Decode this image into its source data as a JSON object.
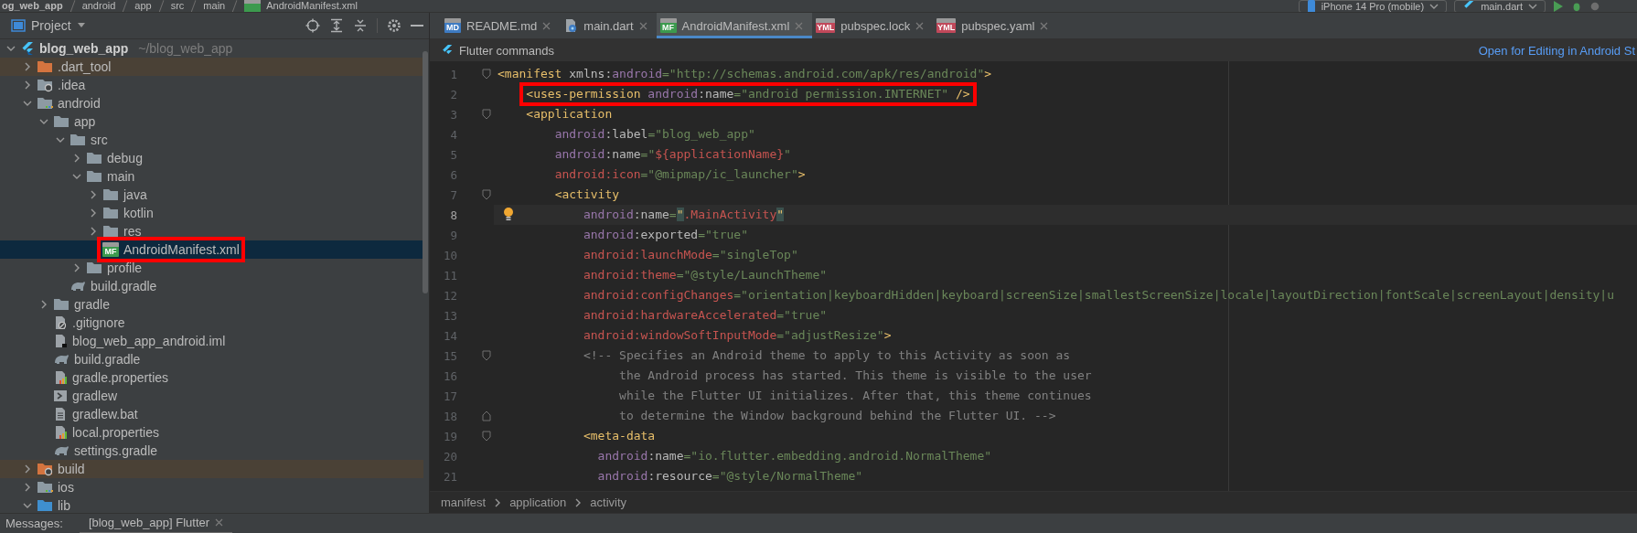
{
  "top_strip": {
    "breadcrumb": [
      "og_web_app",
      "android",
      "app",
      "src",
      "main",
      "AndroidManifest.xml"
    ],
    "device": "iPhone 14 Pro (mobile)",
    "run_config": "main.dart"
  },
  "project_panel": {
    "title": "Project",
    "tree": [
      {
        "label": "blog_web_app",
        "path": "~/blog_web_app",
        "kind": "flutter-project",
        "expanded": true,
        "selected": false,
        "children": [
          {
            "label": ".dart_tool",
            "kind": "folder",
            "expanded": false,
            "excluded": true,
            "selected": false
          },
          {
            "label": ".idea",
            "kind": "config-folder",
            "expanded": false,
            "selected": false
          },
          {
            "label": "android",
            "kind": "module-folder",
            "expanded": true,
            "selected": false,
            "children": [
              {
                "label": "app",
                "kind": "folder",
                "expanded": true,
                "selected": false,
                "children": [
                  {
                    "label": "src",
                    "kind": "folder",
                    "expanded": true,
                    "selected": false,
                    "children": [
                      {
                        "label": "debug",
                        "kind": "folder",
                        "expanded": false,
                        "selected": false
                      },
                      {
                        "label": "main",
                        "kind": "folder",
                        "expanded": true,
                        "selected": false,
                        "children": [
                          {
                            "label": "java",
                            "kind": "folder",
                            "expanded": false,
                            "selected": false
                          },
                          {
                            "label": "kotlin",
                            "kind": "folder",
                            "expanded": false,
                            "selected": false
                          },
                          {
                            "label": "res",
                            "kind": "folder",
                            "expanded": false,
                            "selected": false
                          },
                          {
                            "label": "AndroidManifest.xml",
                            "kind": "manifest",
                            "badge": "MF",
                            "selected": true,
                            "annotated": true
                          }
                        ]
                      },
                      {
                        "label": "profile",
                        "kind": "folder",
                        "expanded": false,
                        "selected": false
                      }
                    ]
                  },
                  {
                    "label": "build.gradle",
                    "kind": "gradle",
                    "selected": false
                  }
                ]
              },
              {
                "label": "gradle",
                "kind": "folder",
                "expanded": false,
                "selected": false
              },
              {
                "label": ".gitignore",
                "kind": "ignore",
                "selected": false
              },
              {
                "label": "blog_web_app_android.iml",
                "kind": "iml",
                "selected": false
              },
              {
                "label": "build.gradle",
                "kind": "gradle",
                "selected": false
              },
              {
                "label": "gradle.properties",
                "kind": "properties",
                "selected": false
              },
              {
                "label": "gradlew",
                "kind": "script",
                "selected": false
              },
              {
                "label": "gradlew.bat",
                "kind": "text",
                "selected": false
              },
              {
                "label": "local.properties",
                "kind": "properties",
                "selected": false
              },
              {
                "label": "settings.gradle",
                "kind": "gradle",
                "selected": false
              }
            ]
          },
          {
            "label": "build",
            "kind": "config-folder",
            "expanded": false,
            "excluded": true,
            "selected": false
          },
          {
            "label": "ios",
            "kind": "module-folder",
            "expanded": false,
            "selected": false
          },
          {
            "label": "lib",
            "kind": "source-folder",
            "expanded": true,
            "selected": false
          }
        ]
      }
    ]
  },
  "editor": {
    "tabs": [
      {
        "label": "README.md",
        "kind": "badge",
        "badge": "MD",
        "selected": false
      },
      {
        "label": "main.dart",
        "kind": "dart",
        "selected": false
      },
      {
        "label": "AndroidManifest.xml",
        "kind": "badge",
        "badge": "MF",
        "selected": true
      },
      {
        "label": "pubspec.lock",
        "kind": "badge",
        "badge": "YML",
        "selected": false
      },
      {
        "label": "pubspec.yaml",
        "kind": "badge",
        "badge": "YML",
        "selected": false
      }
    ],
    "notification": {
      "title": "Flutter commands",
      "link": "Open for Editing in Android St"
    },
    "lines": [
      {
        "number": "1",
        "fold_start": true,
        "tokens": [
          {
            "kind": "tag",
            "text": "<manifest"
          },
          {
            "kind": "attr",
            "text": " xmlns:"
          },
          {
            "kind": "ns",
            "text": "android"
          },
          {
            "kind": "str",
            "text": "=\"http://schemas.android.com/apk/res/android\""
          },
          {
            "kind": "tag",
            "text": ">"
          }
        ]
      },
      {
        "number": "2",
        "annotated": true,
        "tokens": [
          {
            "kind": "tag",
            "text": "    <uses-permission"
          },
          {
            "kind": "ns",
            "text": " android"
          },
          {
            "kind": "attr",
            "text": ":name"
          },
          {
            "kind": "str",
            "text": "=\"android permission.INTERNET\""
          },
          {
            "kind": "tag",
            "text": " />"
          }
        ]
      },
      {
        "number": "3",
        "fold_start": true,
        "tokens": [
          {
            "kind": "tag",
            "text": "    <application"
          }
        ]
      },
      {
        "number": "4",
        "tokens": [
          {
            "kind": "ns",
            "text": "        android"
          },
          {
            "kind": "attr",
            "text": ":label"
          },
          {
            "kind": "str",
            "text": "=\"blog_web_app\""
          }
        ]
      },
      {
        "number": "5",
        "tokens": [
          {
            "kind": "ns",
            "text": "        android"
          },
          {
            "kind": "attr",
            "text": ":name"
          },
          {
            "kind": "str",
            "text": "=\""
          },
          {
            "kind": "err",
            "text": "${applicationName}"
          },
          {
            "kind": "str",
            "text": "\""
          }
        ]
      },
      {
        "number": "6",
        "tokens": [
          {
            "kind": "err",
            "text": "        android:icon"
          },
          {
            "kind": "str",
            "text": "=\"@mipmap/ic_launcher\""
          },
          {
            "kind": "tag",
            "text": ">"
          }
        ]
      },
      {
        "number": "7",
        "fold_start": true,
        "tokens": [
          {
            "kind": "tag",
            "text": "        <activity"
          }
        ]
      },
      {
        "number": "8",
        "current": true,
        "intention": true,
        "tokens": [
          {
            "kind": "ns",
            "text": "            android"
          },
          {
            "kind": "attr",
            "text": ":name"
          },
          {
            "kind": "str",
            "text": "="
          },
          {
            "kind": "match",
            "text": "\""
          },
          {
            "kind": "err",
            "text": ".MainActivity"
          },
          {
            "kind": "match",
            "text": "\""
          }
        ]
      },
      {
        "number": "9",
        "tokens": [
          {
            "kind": "ns",
            "text": "            android"
          },
          {
            "kind": "attr",
            "text": ":exported"
          },
          {
            "kind": "str",
            "text": "=\"true\""
          }
        ]
      },
      {
        "number": "10",
        "tokens": [
          {
            "kind": "err",
            "text": "            android:launchMode"
          },
          {
            "kind": "str",
            "text": "=\"singleTop\""
          }
        ]
      },
      {
        "number": "11",
        "tokens": [
          {
            "kind": "err",
            "text": "            android:theme"
          },
          {
            "kind": "str",
            "text": "=\"@style/LaunchTheme\""
          }
        ]
      },
      {
        "number": "12",
        "tokens": [
          {
            "kind": "err",
            "text": "            android:configChanges"
          },
          {
            "kind": "str",
            "text": "=\"orientation|keyboardHidden|keyboard|screenSize|smallestScreenSize|locale|layoutDirection|fontScale|screenLayout|density|u"
          }
        ]
      },
      {
        "number": "13",
        "tokens": [
          {
            "kind": "err",
            "text": "            android:hardwareAccelerated"
          },
          {
            "kind": "str",
            "text": "=\"true\""
          }
        ]
      },
      {
        "number": "14",
        "tokens": [
          {
            "kind": "err",
            "text": "            android:windowSoftInputMode"
          },
          {
            "kind": "str",
            "text": "=\"adjustResize\""
          },
          {
            "kind": "tag",
            "text": ">"
          }
        ]
      },
      {
        "number": "15",
        "fold_start": true,
        "tokens": [
          {
            "kind": "comment",
            "text": "            <!-- Specifies an Android theme to apply to this Activity as soon as"
          }
        ]
      },
      {
        "number": "16",
        "tokens": [
          {
            "kind": "comment",
            "text": "                 the Android process has started. This theme is visible to the user"
          }
        ]
      },
      {
        "number": "17",
        "tokens": [
          {
            "kind": "comment",
            "text": "                 while the Flutter UI initializes. After that, this theme continues"
          }
        ]
      },
      {
        "number": "18",
        "fold_end": true,
        "tokens": [
          {
            "kind": "comment",
            "text": "                 to determine the Window background behind the Flutter UI. -->"
          }
        ]
      },
      {
        "number": "19",
        "fold_start": true,
        "tokens": [
          {
            "kind": "tag",
            "text": "            <meta-data"
          }
        ]
      },
      {
        "number": "20",
        "tokens": [
          {
            "kind": "ns",
            "text": "              android"
          },
          {
            "kind": "attr",
            "text": ":name"
          },
          {
            "kind": "str",
            "text": "=\"io.flutter.embedding.android.NormalTheme\""
          }
        ]
      },
      {
        "number": "21",
        "tokens": [
          {
            "kind": "ns",
            "text": "              android"
          },
          {
            "kind": "attr",
            "text": ":resource"
          },
          {
            "kind": "str",
            "text": "=\"@style/NormalTheme\""
          }
        ]
      }
    ],
    "breadcrumb": [
      "manifest",
      "application",
      "activity"
    ]
  },
  "messages_bar": {
    "label": "Messages:",
    "tabs": [
      {
        "label": "[blog_web_app] Flutter",
        "selected": true
      }
    ]
  }
}
